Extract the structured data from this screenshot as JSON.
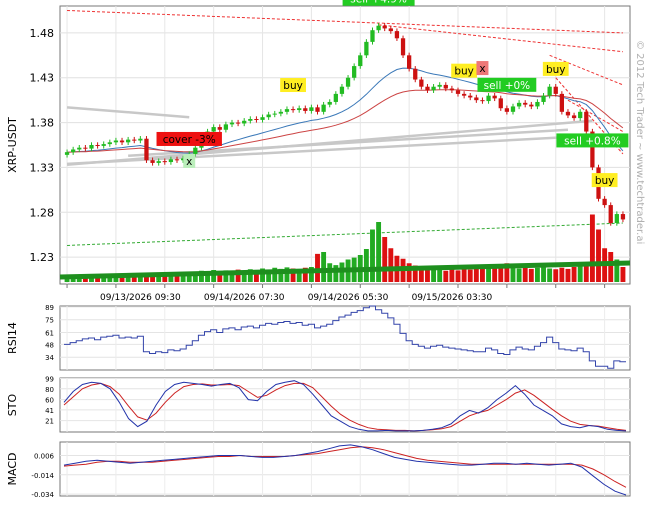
{
  "chart_data": {
    "type": "candlestick",
    "symbol": "XRP-USDT",
    "watermark": "© 2012 Tech Trader ~ www.techtrader.ai",
    "price_panel": {
      "ylabel": "XRP-USDT",
      "ylim": [
        1.2,
        1.51
      ],
      "yticks": [
        1.23,
        1.28,
        1.33,
        1.38,
        1.43,
        1.48
      ],
      "ytick_labels": [
        "1.23",
        "1.28",
        "1.33",
        "1.38",
        "1.43",
        "1.48"
      ],
      "x_labels": [
        "09/13/2026 09:30",
        "09/14/2026 07:30",
        "09/14/2026 05:30",
        "09/15/2026 03:30"
      ],
      "x_label_index": [
        12,
        29,
        46,
        63
      ],
      "n_bars": 92,
      "close": [
        1.347,
        1.35,
        1.352,
        1.351,
        1.355,
        1.354,
        1.356,
        1.358,
        1.36,
        1.358,
        1.361,
        1.36,
        1.362,
        1.338,
        1.335,
        1.337,
        1.336,
        1.339,
        1.338,
        1.34,
        1.345,
        1.352,
        1.365,
        1.37,
        1.375,
        1.372,
        1.378,
        1.38,
        1.379,
        1.382,
        1.384,
        1.383,
        1.386,
        1.389,
        1.39,
        1.392,
        1.395,
        1.394,
        1.396,
        1.393,
        1.397,
        1.392,
        1.4,
        1.403,
        1.412,
        1.42,
        1.43,
        1.443,
        1.455,
        1.47,
        1.483,
        1.488,
        1.485,
        1.482,
        1.474,
        1.455,
        1.44,
        1.428,
        1.42,
        1.416,
        1.42,
        1.422,
        1.418,
        1.416,
        1.412,
        1.41,
        1.408,
        1.405,
        1.404,
        1.41,
        1.407,
        1.396,
        1.392,
        1.398,
        1.402,
        1.4,
        1.398,
        1.403,
        1.41,
        1.42,
        1.412,
        1.392,
        1.388,
        1.385,
        1.392,
        1.37,
        1.33,
        1.295,
        1.288,
        1.268,
        1.278,
        1.272
      ],
      "volume": [
        1.5,
        1.3,
        1.8,
        1.2,
        1.6,
        1.4,
        1.9,
        1.7,
        2.0,
        1.5,
        1.8,
        1.6,
        2.2,
        2.5,
        1.8,
        2.1,
        1.9,
        2.3,
        2.0,
        2.4,
        2.2,
        2.6,
        3.0,
        2.8,
        3.2,
        2.9,
        3.1,
        2.7,
        3.3,
        3.0,
        3.4,
        3.1,
        3.6,
        3.2,
        3.8,
        3.5,
        3.9,
        3.6,
        3.4,
        3.8,
        4.0,
        7.5,
        8.0,
        5.0,
        4.5,
        5.2,
        6.0,
        6.5,
        7.2,
        8.8,
        14.0,
        16.0,
        12.0,
        9.0,
        7.0,
        6.2,
        5.0,
        4.4,
        4.0,
        3.6,
        3.2,
        3.5,
        3.0,
        3.4,
        3.1,
        3.6,
        3.3,
        3.8,
        3.5,
        3.9,
        4.2,
        4.6,
        5.0,
        4.0,
        3.6,
        3.9,
        3.5,
        3.8,
        4.2,
        3.6,
        3.4,
        3.8,
        3.5,
        4.0,
        4.4,
        5.0,
        18.0,
        14.0,
        9.0,
        8.0,
        6.0,
        4.0
      ],
      "vol_max": 16.0,
      "signals": [
        {
          "label": "cover -3%",
          "index": 20,
          "type": "cover"
        },
        {
          "label": "x",
          "index": 20,
          "type": "exit"
        },
        {
          "label": "buy",
          "index": 37,
          "type": "buy"
        },
        {
          "label": "sell +4.9%",
          "index": 51,
          "type": "sell"
        },
        {
          "label": "buy",
          "index": 65,
          "type": "buy"
        },
        {
          "label": "x",
          "index": 68,
          "type": "exit-red"
        },
        {
          "label": "sell +0%",
          "index": 72,
          "type": "sell"
        },
        {
          "label": "buy",
          "index": 80,
          "type": "buy"
        },
        {
          "label": "sell +0.8%",
          "index": 86,
          "type": "sell"
        },
        {
          "label": "buy",
          "index": 88,
          "type": "buy"
        }
      ]
    },
    "rsi_panel": {
      "ylabel": "RSI14",
      "ylim": [
        20,
        90
      ],
      "ytick_labels": [
        "89",
        "75",
        "61",
        "48",
        "34"
      ],
      "yticks": [
        89,
        75,
        61,
        48,
        34
      ],
      "values": [
        48,
        50,
        52,
        54,
        55,
        53,
        56,
        57,
        58,
        55,
        56,
        55,
        57,
        40,
        38,
        40,
        39,
        42,
        41,
        43,
        47,
        52,
        58,
        62,
        64,
        61,
        65,
        66,
        64,
        67,
        68,
        66,
        69,
        71,
        70,
        72,
        73,
        71,
        72,
        69,
        70,
        66,
        68,
        70,
        74,
        78,
        80,
        83,
        85,
        88,
        90,
        86,
        82,
        77,
        70,
        60,
        52,
        48,
        46,
        44,
        46,
        47,
        45,
        44,
        43,
        42,
        41,
        40,
        40,
        44,
        42,
        38,
        37,
        42,
        45,
        43,
        42,
        46,
        50,
        56,
        50,
        43,
        42,
        41,
        44,
        40,
        30,
        24,
        24,
        22,
        30,
        29
      ]
    },
    "sto_panel": {
      "ylabel": "STO",
      "ylim": [
        0,
        100
      ],
      "ytick_labels": [
        "99",
        "80",
        "60",
        "41",
        "21"
      ],
      "yticks": [
        99,
        80,
        60,
        41,
        21
      ],
      "k": [
        55,
        75,
        88,
        92,
        90,
        80,
        55,
        25,
        10,
        20,
        50,
        75,
        88,
        92,
        90,
        88,
        85,
        88,
        90,
        82,
        60,
        58,
        75,
        88,
        92,
        95,
        88,
        70,
        50,
        30,
        20,
        10,
        5,
        2,
        2,
        3,
        2,
        2,
        2,
        3,
        5,
        8,
        15,
        30,
        40,
        35,
        45,
        60,
        72,
        86,
        70,
        50,
        40,
        30,
        15,
        10,
        8,
        12,
        10,
        5,
        3,
        2
      ],
      "d": [
        50,
        65,
        80,
        87,
        90,
        84,
        70,
        48,
        28,
        22,
        35,
        55,
        72,
        84,
        88,
        89,
        87,
        87,
        88,
        86,
        75,
        64,
        68,
        78,
        86,
        90,
        90,
        82,
        65,
        48,
        33,
        22,
        14,
        8,
        5,
        4,
        3,
        3,
        2,
        3,
        4,
        6,
        10,
        20,
        30,
        36,
        40,
        50,
        60,
        72,
        78,
        68,
        55,
        42,
        30,
        20,
        14,
        12,
        11,
        8,
        5,
        3
      ]
    },
    "macd_panel": {
      "ylabel": "MACD",
      "ylim": [
        -0.036,
        0.02
      ],
      "ytick_labels": [
        "0.006",
        "-0.014",
        "-0.034"
      ],
      "yticks": [
        0.006,
        -0.014,
        -0.034
      ],
      "macd": [
        -0.004,
        -0.002,
        0.0,
        0.001,
        0.0,
        -0.001,
        -0.002,
        -0.001,
        0.0,
        0.001,
        0.002,
        0.003,
        0.004,
        0.005,
        0.006,
        0.006,
        0.006,
        0.005,
        0.004,
        0.004,
        0.005,
        0.006,
        0.008,
        0.01,
        0.013,
        0.016,
        0.017,
        0.015,
        0.012,
        0.008,
        0.004,
        0.002,
        0.0,
        -0.001,
        -0.002,
        -0.003,
        -0.004,
        -0.004,
        -0.003,
        -0.002,
        -0.002,
        -0.003,
        -0.002,
        -0.003,
        -0.004,
        -0.003,
        -0.002,
        -0.006,
        -0.015,
        -0.024,
        -0.031,
        -0.035
      ],
      "signal": [
        -0.005,
        -0.004,
        -0.003,
        -0.001,
        0.0,
        0.0,
        -0.001,
        -0.001,
        -0.001,
        0.0,
        0.001,
        0.002,
        0.003,
        0.004,
        0.005,
        0.005,
        0.006,
        0.005,
        0.005,
        0.005,
        0.005,
        0.006,
        0.007,
        0.008,
        0.01,
        0.012,
        0.014,
        0.015,
        0.014,
        0.012,
        0.009,
        0.006,
        0.003,
        0.001,
        0.0,
        -0.001,
        -0.002,
        -0.003,
        -0.003,
        -0.003,
        -0.003,
        -0.003,
        -0.003,
        -0.003,
        -0.003,
        -0.003,
        -0.003,
        -0.004,
        -0.008,
        -0.014,
        -0.021,
        -0.027
      ]
    }
  }
}
